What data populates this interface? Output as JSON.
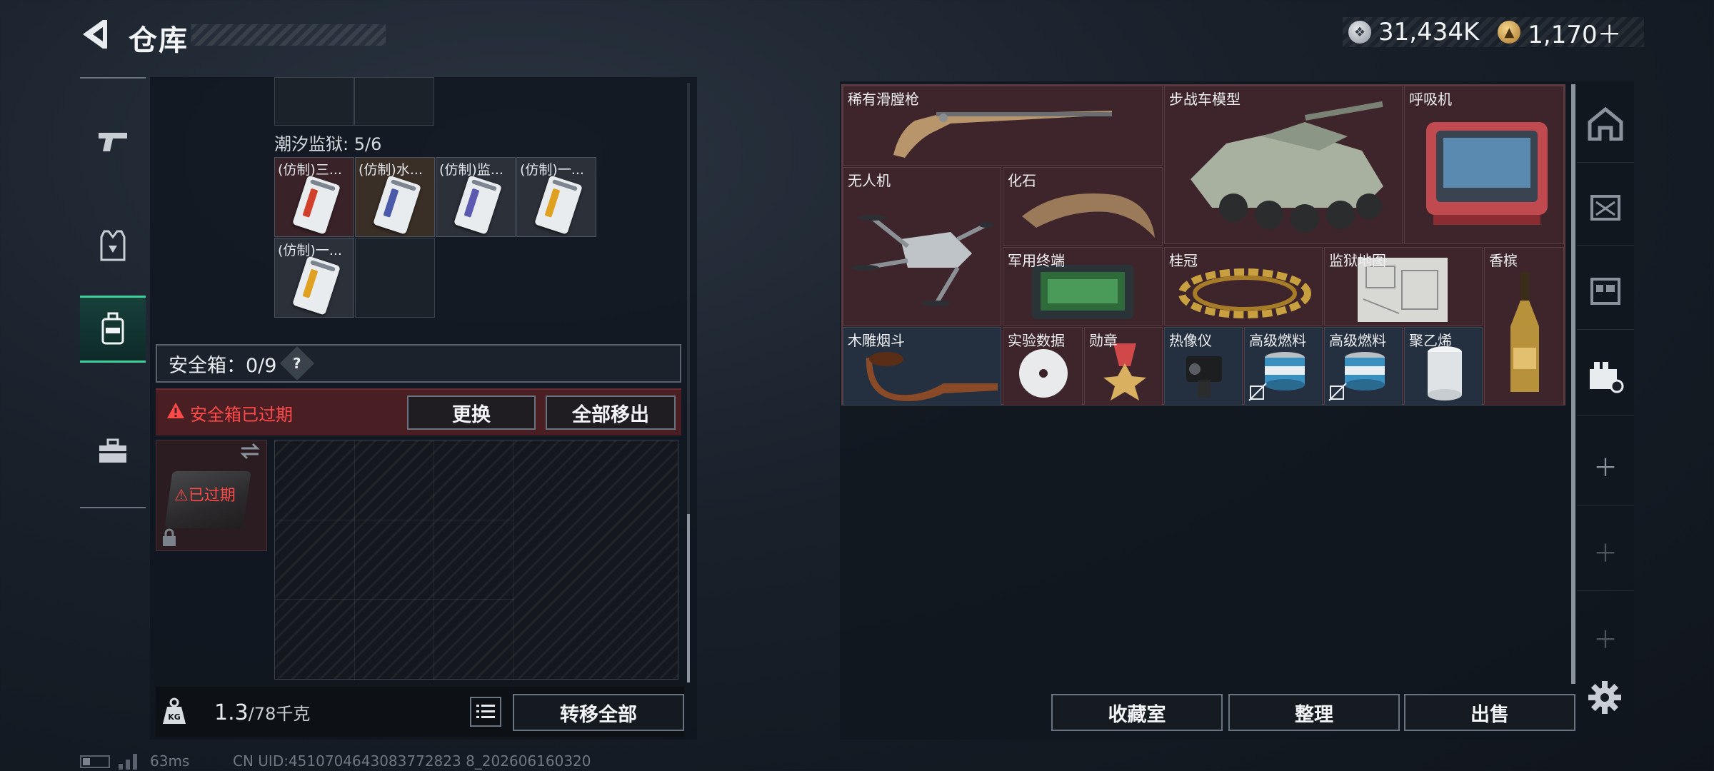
{
  "header": {
    "title": "仓库",
    "currency": [
      {
        "icon": "silver-coin-icon",
        "value": "31,434K"
      },
      {
        "icon": "gold-coin-icon",
        "value": "1,170＋"
      }
    ]
  },
  "left_rail": {
    "tabs": [
      {
        "name": "weapon",
        "icon": "pistol-icon"
      },
      {
        "name": "armor",
        "icon": "vest-icon"
      },
      {
        "name": "backpack",
        "icon": "backpack-icon",
        "active": true
      },
      {
        "name": "toolbox",
        "icon": "toolbox-icon"
      }
    ]
  },
  "container": {
    "label": "潮汐监狱: 5/6",
    "cards": [
      {
        "label": "(仿制)三...",
        "accent": "#d0402a"
      },
      {
        "label": "(仿制)水...",
        "accent": "#4a5aa8"
      },
      {
        "label": "(仿制)监...",
        "accent": "#5b5ab0"
      },
      {
        "label": "(仿制)一...",
        "accent": "#e0a020"
      },
      {
        "label": "(仿制)一...",
        "accent": "#e0a020"
      }
    ]
  },
  "safebox": {
    "label": "安全箱：0/9",
    "help": "?",
    "expired_notice": "安全箱已过期",
    "replace": "更换",
    "move_all": "全部移出",
    "slot_status": "已过期"
  },
  "weight": {
    "current": "1.3",
    "max": "/78千克",
    "transfer_all": "转移全部"
  },
  "collection": {
    "items": [
      {
        "label": "稀有滑膛枪",
        "icon": "musket-icon"
      },
      {
        "label": "步战车模型",
        "icon": "ifv-model-icon"
      },
      {
        "label": "呼吸机",
        "icon": "ventilator-icon"
      },
      {
        "label": "无人机",
        "icon": "drone-icon"
      },
      {
        "label": "化石",
        "icon": "fossil-claw-icon"
      },
      {
        "label": "军用终端",
        "icon": "military-terminal-icon"
      },
      {
        "label": "桂冠",
        "icon": "laurel-crown-icon"
      },
      {
        "label": "监狱地图",
        "icon": "prison-map-icon"
      },
      {
        "label": "香槟",
        "icon": "champagne-icon"
      },
      {
        "label": "木雕烟斗",
        "icon": "pipe-icon"
      },
      {
        "label": "实验数据",
        "icon": "disc-icon"
      },
      {
        "label": "勋章",
        "icon": "medal-icon"
      },
      {
        "label": "热像仪",
        "icon": "thermal-imager-icon"
      },
      {
        "label": "高级燃料",
        "icon": "fuel-can-icon"
      },
      {
        "label": "高级燃料",
        "icon": "fuel-can-icon"
      },
      {
        "label": "聚乙烯",
        "icon": "polyethylene-roll-icon"
      }
    ]
  },
  "actions": {
    "vault": "收藏室",
    "sort": "整理",
    "sell": "出售"
  },
  "footer": {
    "latency": "63ms",
    "uid": "CN UID:4510704643083772823 8_202606160320"
  }
}
